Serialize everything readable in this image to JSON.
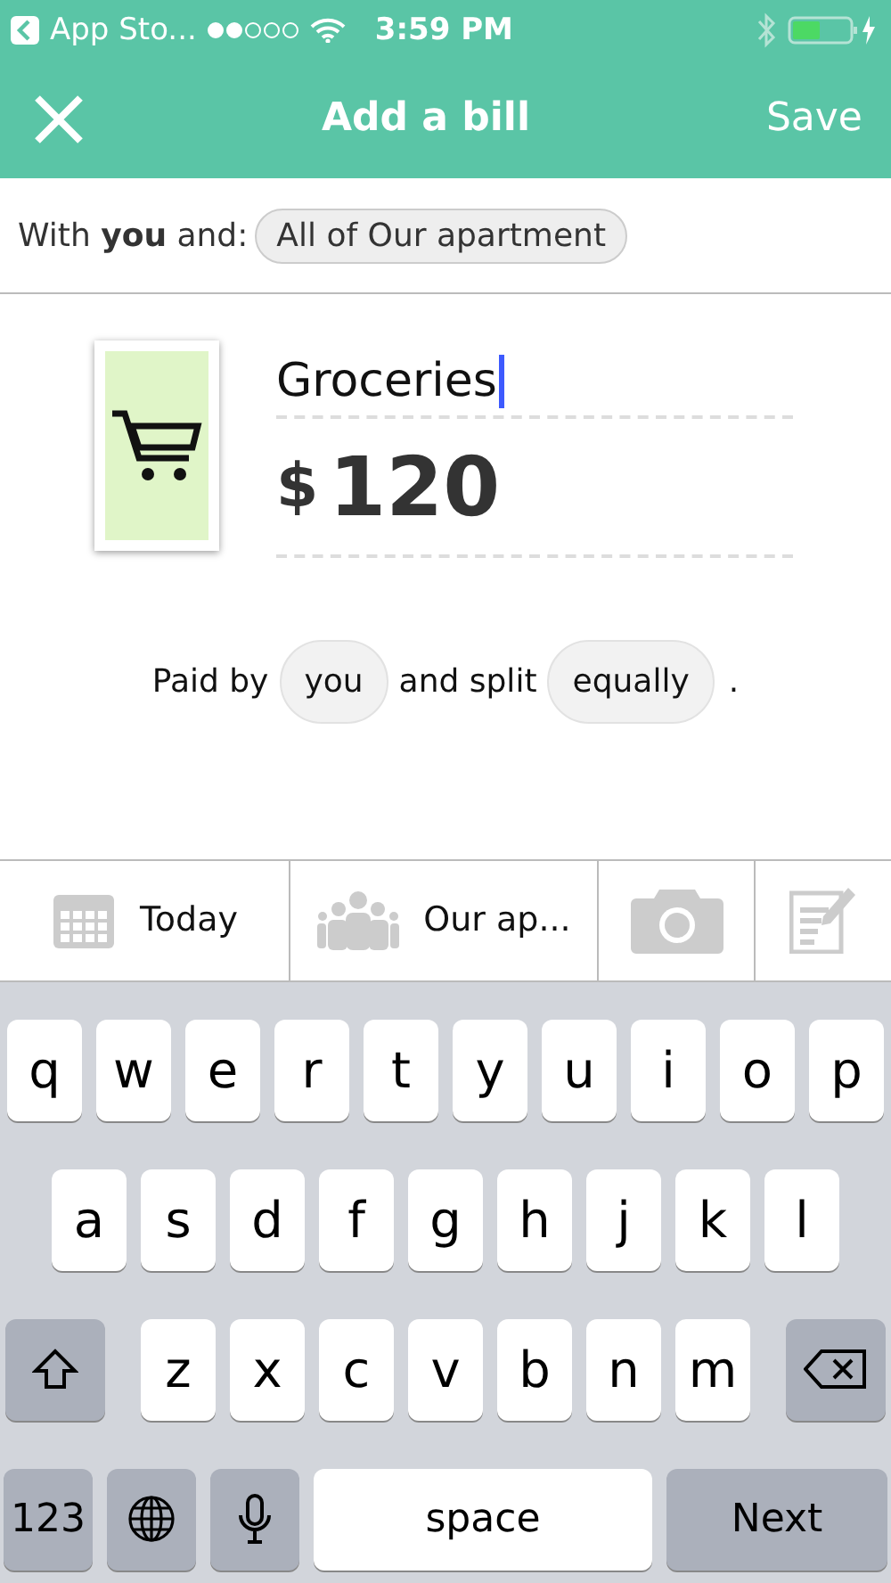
{
  "status_bar": {
    "back_label": "App Sto...",
    "time": "3:59 PM"
  },
  "nav": {
    "title": "Add a bill",
    "save": "Save"
  },
  "with_row": {
    "text": "With **you** and:",
    "group": "All of Our apartment"
  },
  "bill": {
    "description": "Groceries",
    "currency": "$",
    "amount": "120"
  },
  "split": {
    "paid_by_label": "Paid by",
    "payer": "you",
    "split_label": "and split",
    "method": "equally",
    "end": "."
  },
  "toolbar": [
    {
      "kind": "date",
      "label": "Today"
    },
    {
      "kind": "group",
      "label": "Our ap..."
    },
    {
      "kind": "camera"
    },
    {
      "kind": "notes"
    }
  ],
  "keyboard": [
    [
      {
        "kind": "letter",
        "label": "q"
      },
      {
        "kind": "letter",
        "label": "w"
      },
      {
        "kind": "letter",
        "label": "e"
      },
      {
        "kind": "letter",
        "label": "r"
      },
      {
        "kind": "letter",
        "label": "t"
      },
      {
        "kind": "letter",
        "label": "y"
      },
      {
        "kind": "letter",
        "label": "u"
      },
      {
        "kind": "letter",
        "label": "i"
      },
      {
        "kind": "letter",
        "label": "o"
      },
      {
        "kind": "letter",
        "label": "p"
      }
    ],
    [
      {
        "kind": "letter",
        "label": "a"
      },
      {
        "kind": "letter",
        "label": "s"
      },
      {
        "kind": "letter",
        "label": "d"
      },
      {
        "kind": "letter",
        "label": "f"
      },
      {
        "kind": "letter",
        "label": "g"
      },
      {
        "kind": "letter",
        "label": "h"
      },
      {
        "kind": "letter",
        "label": "j"
      },
      {
        "kind": "letter",
        "label": "k"
      },
      {
        "kind": "letter",
        "label": "l"
      }
    ],
    [
      {
        "kind": "shift"
      },
      {
        "kind": "letter",
        "label": "z"
      },
      {
        "kind": "letter",
        "label": "x"
      },
      {
        "kind": "letter",
        "label": "c"
      },
      {
        "kind": "letter",
        "label": "v"
      },
      {
        "kind": "letter",
        "label": "b"
      },
      {
        "kind": "letter",
        "label": "n"
      },
      {
        "kind": "letter",
        "label": "m"
      },
      {
        "kind": "backspace"
      }
    ],
    [
      {
        "kind": "numbers",
        "label": "123"
      },
      {
        "kind": "globe"
      },
      {
        "kind": "mic"
      },
      {
        "kind": "space",
        "label": "space"
      },
      {
        "kind": "next",
        "label": "Next"
      }
    ]
  ]
}
